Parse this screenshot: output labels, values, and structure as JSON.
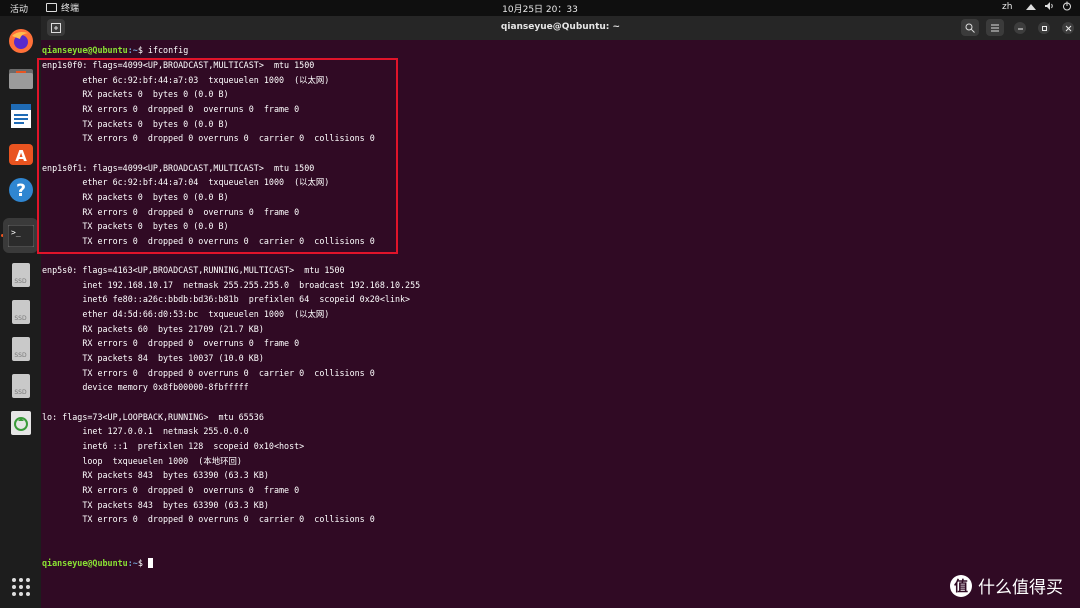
{
  "topbar": {
    "activities": "活动",
    "app_name": "终端",
    "clock": "10月25日 20：33",
    "lang": "zh",
    "tray": {
      "network": "network-icon",
      "volume": "volume-icon",
      "power": "power-icon"
    }
  },
  "dock": {
    "items": [
      "firefox",
      "files",
      "libreoffice-writer",
      "app-center",
      "help",
      "terminal",
      "ssd-1",
      "ssd-2",
      "ssd-3",
      "ssd-4",
      "trash"
    ],
    "ssd_label": "SSD",
    "show_apps": "apps-grid-icon"
  },
  "window": {
    "title": "qianseyue@Qubuntu: ~"
  },
  "terminal": {
    "prompt_user": "qianseyue@Qubuntu",
    "prompt_path": ":~",
    "prompt_symbol": "$ ",
    "command": "ifconfig",
    "lines": [
      "enp1s0f0: flags=4099<UP,BROADCAST,MULTICAST>  mtu 1500",
      "        ether 6c:92:bf:44:a7:03  txqueuelen 1000  (以太网)",
      "        RX packets 0  bytes 0 (0.0 B)",
      "        RX errors 0  dropped 0  overruns 0  frame 0",
      "        TX packets 0  bytes 0 (0.0 B)",
      "        TX errors 0  dropped 0 overruns 0  carrier 0  collisions 0",
      "",
      "enp1s0f1: flags=4099<UP,BROADCAST,MULTICAST>  mtu 1500",
      "        ether 6c:92:bf:44:a7:04  txqueuelen 1000  (以太网)",
      "        RX packets 0  bytes 0 (0.0 B)",
      "        RX errors 0  dropped 0  overruns 0  frame 0",
      "        TX packets 0  bytes 0 (0.0 B)",
      "        TX errors 0  dropped 0 overruns 0  carrier 0  collisions 0",
      "",
      "enp5s0: flags=4163<UP,BROADCAST,RUNNING,MULTICAST>  mtu 1500",
      "        inet 192.168.10.17  netmask 255.255.255.0  broadcast 192.168.10.255",
      "        inet6 fe80::a26c:bbdb:bd36:b81b  prefixlen 64  scopeid 0x20<link>",
      "        ether d4:5d:66:d0:53:bc  txqueuelen 1000  (以太网)",
      "        RX packets 60  bytes 21709 (21.7 KB)",
      "        RX errors 0  dropped 0  overruns 0  frame 0",
      "        TX packets 84  bytes 10037 (10.0 KB)",
      "        TX errors 0  dropped 0 overruns 0  carrier 0  collisions 0",
      "        device memory 0x8fb00000-8fbfffff",
      "",
      "lo: flags=73<UP,LOOPBACK,RUNNING>  mtu 65536",
      "        inet 127.0.0.1  netmask 255.0.0.0",
      "        inet6 ::1  prefixlen 128  scopeid 0x10<host>",
      "        loop  txqueuelen 1000  (本地环回)",
      "        RX packets 843  bytes 63390 (63.3 KB)",
      "        RX errors 0  dropped 0  overruns 0  frame 0",
      "        TX packets 843  bytes 63390 (63.3 KB)",
      "        TX errors 0  dropped 0 overruns 0  carrier 0  collisions 0",
      ""
    ]
  },
  "watermark": {
    "text": "什么值得买",
    "logo_char": "值"
  }
}
